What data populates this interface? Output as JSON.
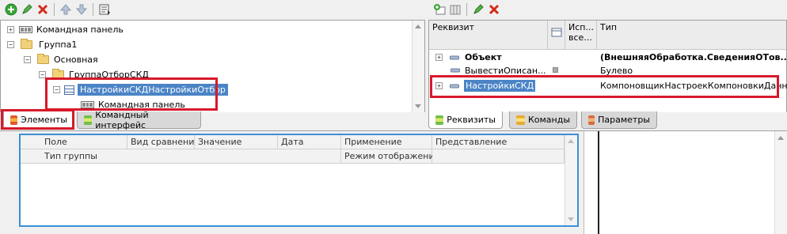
{
  "left_toolbar": {
    "icons": [
      "add-icon",
      "edit-icon",
      "delete-icon",
      "move-up-icon",
      "move-down-icon",
      "form-settings-icon"
    ]
  },
  "tree": {
    "items": [
      {
        "label": "Командная панель",
        "icon": "command-panel-icon",
        "expander": "+"
      },
      {
        "label": "Группа1",
        "icon": "folder-icon",
        "expander": "−"
      },
      {
        "label": "Основная",
        "icon": "folder-icon",
        "expander": "−"
      },
      {
        "label": "ГруппаОтборСКД",
        "icon": "folder-icon",
        "expander": "−"
      },
      {
        "label": "НастройкиСКДНастройкиОтбор",
        "icon": "table-icon",
        "expander": "−",
        "selected": true
      },
      {
        "label": "Командная панель",
        "icon": "command-panel-icon",
        "expander": ""
      }
    ]
  },
  "left_tabs": [
    {
      "label": "Элементы",
      "active": true
    },
    {
      "label": "Командный интерфейс",
      "active": false
    }
  ],
  "right_toolbar": {
    "icons": [
      "add-attribute-icon",
      "add-column-icon",
      "edit-icon",
      "delete-icon"
    ]
  },
  "attributes": {
    "headers": {
      "name": "Реквизит",
      "use_always_1": "Исп...",
      "use_always_2": "все...",
      "type": "Тип"
    },
    "rows": [
      {
        "name": "Объект",
        "type": "(ВнешняяОбработка.СведенияОТов...",
        "bold": true,
        "expander": "+"
      },
      {
        "name": "ВывестиОписан...",
        "type": "Булево",
        "bold": false,
        "expander": ""
      },
      {
        "name": "НастройкиСКД",
        "type": "КомпоновщикНастроекКомпоновкиДанных",
        "bold": false,
        "expander": "+",
        "selected": true
      }
    ]
  },
  "right_tabs": [
    {
      "label": "Реквизиты",
      "active": true
    },
    {
      "label": "Команды",
      "active": false
    },
    {
      "label": "Параметры",
      "active": false
    }
  ],
  "filter_table": {
    "row1": [
      "Поле",
      "Вид сравнения",
      "Значение",
      "Дата",
      "Применение",
      "Представление"
    ],
    "row2": [
      "Тип группы",
      "Режим отображения"
    ]
  },
  "colors": {
    "highlight_red": "#d7192a",
    "selection_blue": "#4b84c6",
    "focus_blue": "#3c8fd6"
  }
}
